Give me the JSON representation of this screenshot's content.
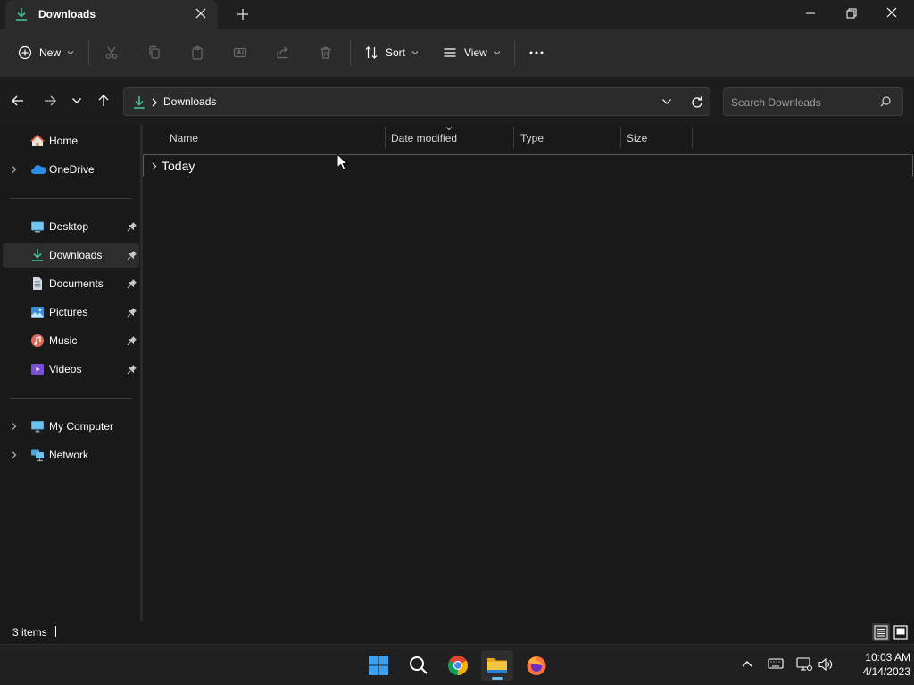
{
  "window": {
    "tab_title": "Downloads",
    "tab_icon": "download-icon",
    "controls": [
      "minimize-icon",
      "restore-icon",
      "close-icon"
    ]
  },
  "commandbar": {
    "new_label": "New",
    "sort_label": "Sort",
    "view_label": "View",
    "actions": [
      "cut-icon",
      "copy-icon",
      "paste-icon",
      "rename-icon",
      "share-icon",
      "delete-icon",
      "more-icon"
    ]
  },
  "address": {
    "crumb": "Downloads",
    "search_placeholder": "Search Downloads"
  },
  "sidebar": {
    "items": [
      {
        "label": "Home",
        "icon": "home-icon"
      },
      {
        "label": "OneDrive",
        "icon": "onedrive-icon"
      },
      {
        "label": "Desktop",
        "icon": "desktop-icon",
        "pinned": true
      },
      {
        "label": "Downloads",
        "icon": "downloads-icon",
        "pinned": true,
        "selected": true
      },
      {
        "label": "Documents",
        "icon": "documents-icon",
        "pinned": true
      },
      {
        "label": "Pictures",
        "icon": "pictures-icon",
        "pinned": true
      },
      {
        "label": "Music",
        "icon": "music-icon",
        "pinned": true
      },
      {
        "label": "Videos",
        "icon": "videos-icon",
        "pinned": true
      },
      {
        "label": "My Computer",
        "icon": "computer-icon"
      },
      {
        "label": "Network",
        "icon": "network-icon"
      }
    ]
  },
  "columns": {
    "name": "Name",
    "date_modified": "Date modified",
    "type": "Type",
    "size": "Size"
  },
  "groups": [
    {
      "label": "Today",
      "expanded": false
    }
  ],
  "status": {
    "items": "3 items"
  },
  "taskbar": {
    "apps": [
      "start-icon",
      "search-icon",
      "chrome-icon",
      "file-explorer-icon",
      "firefox-icon"
    ],
    "active_app": "file-explorer-icon",
    "time": "10:03 AM",
    "date": "4/14/2023"
  },
  "colors": {
    "accent_green": "#3fbf8f",
    "folder_yellow": "#f4c842",
    "selection": "#2d2d2d",
    "win_blue": "#3aa0f0"
  }
}
